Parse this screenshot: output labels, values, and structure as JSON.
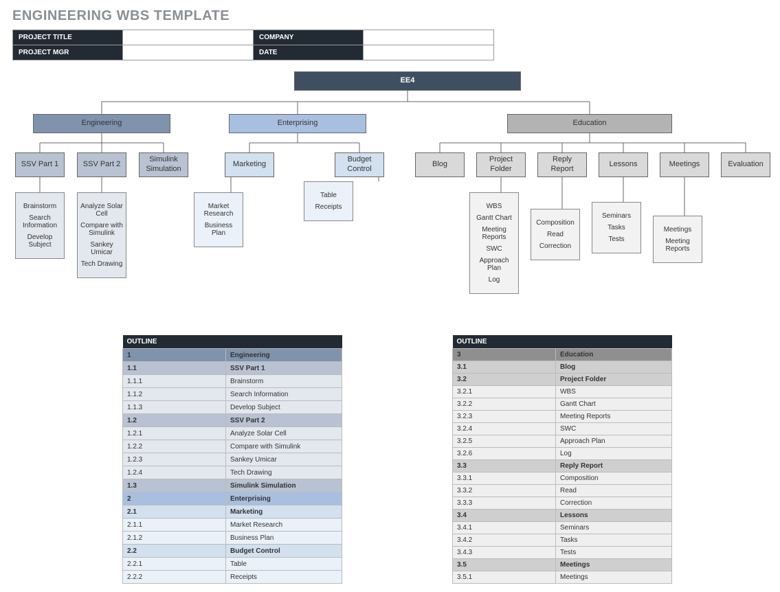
{
  "title": "ENGINEERING WBS TEMPLATE",
  "meta": {
    "project_title_label": "PROJECT TITLE",
    "project_title_value": "",
    "company_label": "COMPANY",
    "company_value": "",
    "project_mgr_label": "PROJECT MGR",
    "project_mgr_value": "",
    "date_label": "DATE",
    "date_value": ""
  },
  "colors": {
    "root": "#3f4f61",
    "engineering": "#8093ad",
    "engineering_sub": "#b8c2d2",
    "enterprising": "#a9bfe0",
    "enterprising_sub": "#d2e0ef",
    "enterprising_leaf": "#eaf1f8",
    "education": "#b3b3b3",
    "education_sub": "#d9d9d9",
    "education_leaf": "#f2f2f2"
  },
  "chart": {
    "root": "EE4",
    "engineering": {
      "label": "Engineering",
      "children": {
        "ssv1": {
          "label": "SSV Part 1",
          "items": [
            "Brainstorm",
            "Search Information",
            "Develop Subject"
          ]
        },
        "ssv2": {
          "label": "SSV Part 2",
          "items": [
            "Analyze Solar Cell",
            "Compare with Simulink",
            "Sankey Umicar",
            "Tech Drawing"
          ]
        },
        "simulink": {
          "label": "Simulink Simulation"
        }
      }
    },
    "enterprising": {
      "label": "Enterprising",
      "children": {
        "marketing": {
          "label": "Marketing",
          "items": [
            "Market Research",
            "Business Plan"
          ]
        },
        "budget": {
          "label": "Budget Control",
          "items": [
            "Table",
            "Receipts"
          ]
        }
      }
    },
    "education": {
      "label": "Education",
      "children": {
        "blog": {
          "label": "Blog"
        },
        "project_folder": {
          "label": "Project Folder",
          "items": [
            "WBS",
            "Gantt Chart",
            "Meeting Reports",
            "SWC",
            "Approach Plan",
            "Log"
          ]
        },
        "reply_report": {
          "label": "Reply Report",
          "items": [
            "Composition",
            "Read",
            "Correction"
          ]
        },
        "lessons": {
          "label": "Lessons",
          "items": [
            "Seminars",
            "Tasks",
            "Tests"
          ]
        },
        "meetings": {
          "label": "Meetings",
          "items": [
            "Meetings",
            "Meeting Reports"
          ]
        },
        "evaluation": {
          "label": "Evaluation"
        }
      }
    }
  },
  "outline1": {
    "header": "OUTLINE",
    "rows": [
      {
        "n": "1",
        "t": "Engineering",
        "bg": "#8093ad",
        "bold": true
      },
      {
        "n": "1.1",
        "t": "SSV Part 1",
        "bg": "#b8c2d2",
        "bold": true
      },
      {
        "n": "1.1.1",
        "t": "Brainstorm",
        "bg": "#e3e7ee"
      },
      {
        "n": "1.1.2",
        "t": "Search Information",
        "bg": "#e3e7ee"
      },
      {
        "n": "1.1.3",
        "t": "Develop Subject",
        "bg": "#e3e7ee"
      },
      {
        "n": "1.2",
        "t": "SSV Part 2",
        "bg": "#b8c2d2",
        "bold": true
      },
      {
        "n": "1.2.1",
        "t": "Analyze Solar Cell",
        "bg": "#e3e7ee"
      },
      {
        "n": "1.2.2",
        "t": "Compare with Simulink",
        "bg": "#e3e7ee"
      },
      {
        "n": "1.2.3",
        "t": "Sankey Umicar",
        "bg": "#e3e7ee"
      },
      {
        "n": "1.2.4",
        "t": "Tech Drawing",
        "bg": "#e3e7ee"
      },
      {
        "n": "1.3",
        "t": "Simulink Simulation",
        "bg": "#b8c2d2",
        "bold": true
      },
      {
        "n": "2",
        "t": "Enterprising",
        "bg": "#a9bfe0",
        "bold": true
      },
      {
        "n": "2.1",
        "t": "Marketing",
        "bg": "#d2e0ef",
        "bold": true
      },
      {
        "n": "2.1.1",
        "t": "Market Research",
        "bg": "#eaf1f8"
      },
      {
        "n": "2.1.2",
        "t": "Business Plan",
        "bg": "#eaf1f8"
      },
      {
        "n": "2.2",
        "t": "Budget Control",
        "bg": "#d2e0ef",
        "bold": true
      },
      {
        "n": "2.2.1",
        "t": "Table",
        "bg": "#eaf1f8"
      },
      {
        "n": "2.2.2",
        "t": "Receipts",
        "bg": "#eaf1f8"
      }
    ]
  },
  "outline2": {
    "header": "OUTLINE",
    "rows": [
      {
        "n": "3",
        "t": "Education",
        "bg": "#8f8f8f",
        "bold": true
      },
      {
        "n": "3.1",
        "t": "Blog",
        "bg": "#cfcfcf",
        "bold": true
      },
      {
        "n": "3.2",
        "t": "Project Folder",
        "bg": "#cfcfcf",
        "bold": true
      },
      {
        "n": "3.2.1",
        "t": "WBS",
        "bg": "#efefef"
      },
      {
        "n": "3.2.2",
        "t": "Gantt Chart",
        "bg": "#efefef"
      },
      {
        "n": "3.2.3",
        "t": "Meeting Reports",
        "bg": "#efefef"
      },
      {
        "n": "3.2.4",
        "t": "SWC",
        "bg": "#efefef"
      },
      {
        "n": "3.2.5",
        "t": "Approach Plan",
        "bg": "#efefef"
      },
      {
        "n": "3.2.6",
        "t": "Log",
        "bg": "#efefef"
      },
      {
        "n": "3.3",
        "t": "Reply Report",
        "bg": "#cfcfcf",
        "bold": true
      },
      {
        "n": "3.3.1",
        "t": "Composition",
        "bg": "#efefef"
      },
      {
        "n": "3.3.2",
        "t": "Read",
        "bg": "#efefef"
      },
      {
        "n": "3.3.3",
        "t": "Correction",
        "bg": "#efefef"
      },
      {
        "n": "3.4",
        "t": "Lessons",
        "bg": "#cfcfcf",
        "bold": true
      },
      {
        "n": "3.4.1",
        "t": "Seminars",
        "bg": "#efefef"
      },
      {
        "n": "3.4.2",
        "t": "Tasks",
        "bg": "#efefef"
      },
      {
        "n": "3.4.3",
        "t": "Tests",
        "bg": "#efefef"
      },
      {
        "n": "3.5",
        "t": "Meetings",
        "bg": "#cfcfcf",
        "bold": true
      },
      {
        "n": "3.5.1",
        "t": "Meetings",
        "bg": "#efefef"
      }
    ]
  }
}
